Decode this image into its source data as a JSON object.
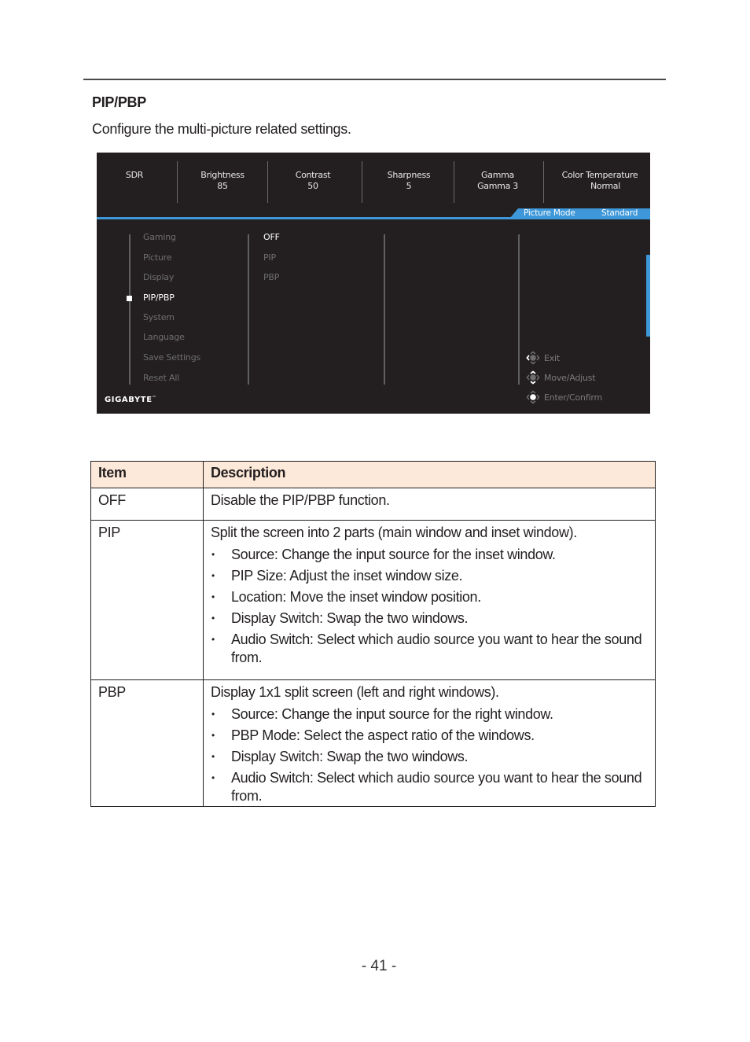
{
  "section": {
    "title": "PIP/PBP",
    "description": "Configure the multi-picture related settings."
  },
  "osd": {
    "topbar": [
      {
        "label": "SDR",
        "value": ""
      },
      {
        "label": "Brightness",
        "value": "85"
      },
      {
        "label": "Contrast",
        "value": "50"
      },
      {
        "label": "Sharpness",
        "value": "5"
      },
      {
        "label": "Gamma",
        "value": "Gamma 3"
      },
      {
        "label": "Color Temperature",
        "value": "Normal"
      }
    ],
    "mode_badge": {
      "label": "Picture Mode",
      "value": "Standard"
    },
    "menu": [
      {
        "label": "Gaming"
      },
      {
        "label": "Picture"
      },
      {
        "label": "Display"
      },
      {
        "label": "PIP/PBP",
        "selected": true
      },
      {
        "label": "System"
      },
      {
        "label": "Language"
      },
      {
        "label": "Save Settings"
      },
      {
        "label": "Reset All"
      }
    ],
    "options": [
      {
        "label": "OFF",
        "selected": true
      },
      {
        "label": "PIP"
      },
      {
        "label": "PBP"
      }
    ],
    "hints": [
      {
        "icon": "joystick-left-icon",
        "label": "Exit"
      },
      {
        "icon": "joystick-move-icon",
        "label": "Move/Adjust"
      },
      {
        "icon": "joystick-press-icon",
        "label": "Enter/Confirm"
      }
    ],
    "logo": "GIGABYTE",
    "logo_tm": "™",
    "colors": {
      "background": "#231f20",
      "accent": "#3d97d8",
      "inactive_text": "#6e6e6e"
    }
  },
  "table": {
    "headers": {
      "item": "Item",
      "description": "Description"
    },
    "header_color": "#fde9d9",
    "rows": [
      {
        "item": "OFF",
        "description": "Disable the PIP/PBP function.",
        "bullets": []
      },
      {
        "item": "PIP",
        "description": "Split the screen into 2 parts (main window and inset window).",
        "bullets": [
          "Source: Change the input source for the inset window.",
          "PIP Size: Adjust the inset window size.",
          "Location:  Move the inset window position.",
          "Display Switch: Swap the two windows.",
          "Audio Switch: Select which audio source you want to hear the sound from."
        ]
      },
      {
        "item": "PBP",
        "description": "Display 1x1 split screen (left and right windows).",
        "bullets": [
          "Source: Change the input source for the right window.",
          "PBP Mode: Select the aspect ratio of the windows.",
          "Display Switch: Swap the two windows.",
          "Audio Switch: Select which audio source you want to hear the sound from."
        ]
      }
    ]
  },
  "page_number": "- 41 -"
}
